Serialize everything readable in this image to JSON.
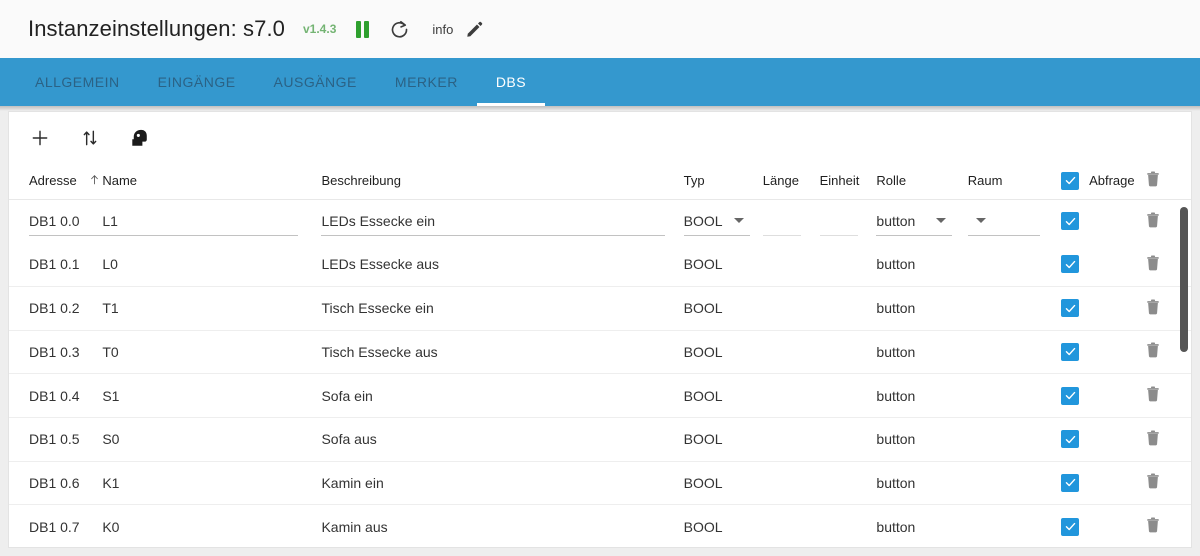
{
  "header": {
    "title": "Instanzeinstellungen: s7.0",
    "version": "v1.4.3",
    "pause_label": "pause-icon",
    "refresh_label": "refresh-icon",
    "info_label": "info",
    "edit_label": "edit-icon"
  },
  "tabs": [
    {
      "label": "ALLGEMEIN",
      "active": false
    },
    {
      "label": "EINGÄNGE",
      "active": false
    },
    {
      "label": "AUSGÄNGE",
      "active": false
    },
    {
      "label": "MERKER",
      "active": false
    },
    {
      "label": "DBS",
      "active": true
    }
  ],
  "toolbar": {
    "add_label": "add-icon",
    "sort_label": "sort-icon",
    "profile_label": "head-profile-icon"
  },
  "table": {
    "columns": {
      "adresse": "Adresse",
      "name": "Name",
      "beschreibung": "Beschreibung",
      "typ": "Typ",
      "laenge": "Länge",
      "einheit": "Einheit",
      "rolle": "Rolle",
      "raum": "Raum",
      "abfrage": "Abfrage"
    },
    "sort_column": "adresse",
    "sort_direction": "asc",
    "header_checkbox_checked": true,
    "rows": [
      {
        "editing": true,
        "adresse": "DB1 0.0",
        "name": "L1",
        "beschreibung": "LEDs Essecke ein",
        "typ": "BOOL",
        "laenge": "",
        "einheit": "",
        "rolle": "button",
        "raum": "",
        "abfrage": true
      },
      {
        "editing": false,
        "adresse": "DB1 0.1",
        "name": "L0",
        "beschreibung": "LEDs Essecke aus",
        "typ": "BOOL",
        "laenge": "",
        "einheit": "",
        "rolle": "button",
        "raum": "",
        "abfrage": true
      },
      {
        "editing": false,
        "adresse": "DB1 0.2",
        "name": "T1",
        "beschreibung": "Tisch Essecke ein",
        "typ": "BOOL",
        "laenge": "",
        "einheit": "",
        "rolle": "button",
        "raum": "",
        "abfrage": true
      },
      {
        "editing": false,
        "adresse": "DB1 0.3",
        "name": "T0",
        "beschreibung": "Tisch Essecke aus",
        "typ": "BOOL",
        "laenge": "",
        "einheit": "",
        "rolle": "button",
        "raum": "",
        "abfrage": true
      },
      {
        "editing": false,
        "adresse": "DB1 0.4",
        "name": "S1",
        "beschreibung": "Sofa ein",
        "typ": "BOOL",
        "laenge": "",
        "einheit": "",
        "rolle": "button",
        "raum": "",
        "abfrage": true
      },
      {
        "editing": false,
        "adresse": "DB1 0.5",
        "name": "S0",
        "beschreibung": "Sofa aus",
        "typ": "BOOL",
        "laenge": "",
        "einheit": "",
        "rolle": "button",
        "raum": "",
        "abfrage": true
      },
      {
        "editing": false,
        "adresse": "DB1 0.6",
        "name": "K1",
        "beschreibung": "Kamin ein",
        "typ": "BOOL",
        "laenge": "",
        "einheit": "",
        "rolle": "button",
        "raum": "",
        "abfrage": true
      },
      {
        "editing": false,
        "adresse": "DB1 0.7",
        "name": "K0",
        "beschreibung": "Kamin aus",
        "typ": "BOOL",
        "laenge": "",
        "einheit": "",
        "rolle": "button",
        "raum": "",
        "abfrage": true
      }
    ]
  },
  "colors": {
    "tabbar": "#3498ce",
    "accent_checkbox": "#2196dc",
    "version_green": "#74b473",
    "pause_green": "#2ea02e"
  }
}
